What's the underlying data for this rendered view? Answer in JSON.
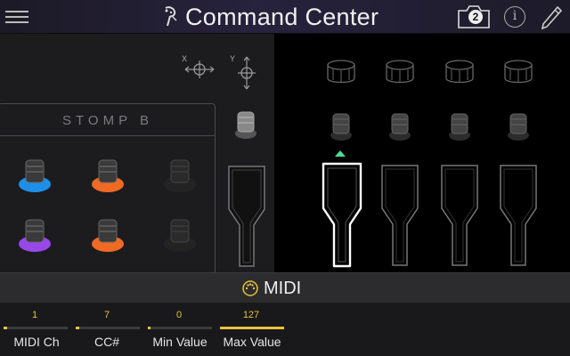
{
  "header": {
    "title": "Command Center",
    "menu_icon": "hamburger-icon",
    "title_icon": "command-center-icon",
    "snapshot_icon": "camera-icon",
    "snapshot_count": "2",
    "info_label": "i",
    "edit_icon": "pencil-icon"
  },
  "left_panel": {
    "x_label": "X",
    "y_label": "Y",
    "stomp_label": "STOMP B",
    "footswitches": [
      {
        "name": "fs-1",
        "ring_color": "#1e8fe8",
        "state": "lit"
      },
      {
        "name": "fs-2",
        "ring_color": "#f06a24",
        "state": "lit"
      },
      {
        "name": "fs-3",
        "ring_color": "#2a2a2a",
        "state": "off"
      },
      {
        "name": "fs-4",
        "ring_color": "#9848e8",
        "state": "lit"
      },
      {
        "name": "fs-5",
        "ring_color": "#f06a24",
        "state": "lit"
      },
      {
        "name": "fs-6",
        "ring_color": "#2a2a2a",
        "state": "off"
      }
    ]
  },
  "right_panel": {
    "selected_slot": 1,
    "selected_color": "#4ddc96"
  },
  "midi": {
    "title": "MIDI",
    "params": [
      {
        "label": "MIDI Ch",
        "value": "1",
        "fill": 0.06
      },
      {
        "label": "CC#",
        "value": "7",
        "fill": 0.06
      },
      {
        "label": "Min Value",
        "value": "0",
        "fill": 0.0
      },
      {
        "label": "Max Value",
        "value": "127",
        "fill": 1.0
      }
    ]
  }
}
